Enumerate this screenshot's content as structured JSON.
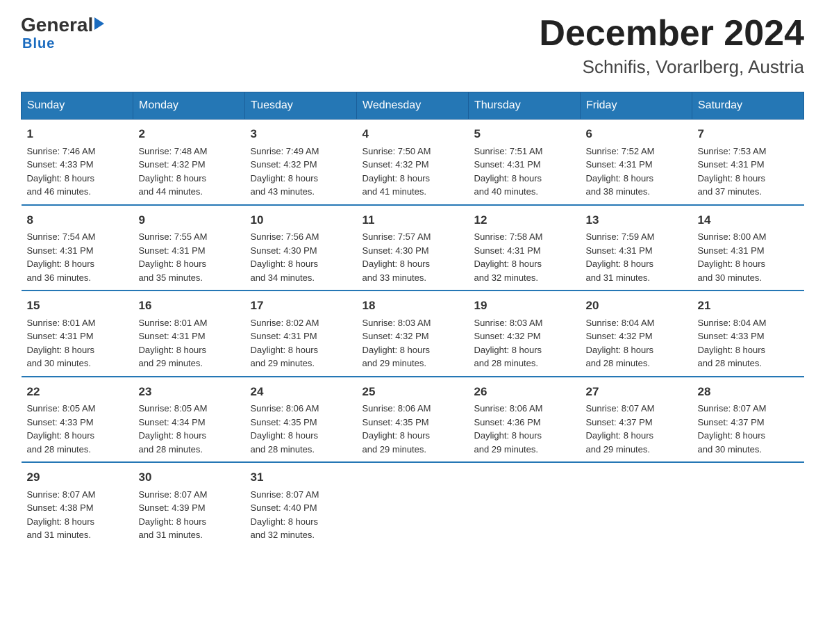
{
  "logo": {
    "general": "General",
    "arrow": "",
    "blue_underline": "Blue"
  },
  "title": "December 2024",
  "subtitle": "Schnifis, Vorarlberg, Austria",
  "days_of_week": [
    "Sunday",
    "Monday",
    "Tuesday",
    "Wednesday",
    "Thursday",
    "Friday",
    "Saturday"
  ],
  "weeks": [
    [
      {
        "day": "1",
        "sunrise": "7:46 AM",
        "sunset": "4:33 PM",
        "daylight": "8 hours and 46 minutes."
      },
      {
        "day": "2",
        "sunrise": "7:48 AM",
        "sunset": "4:32 PM",
        "daylight": "8 hours and 44 minutes."
      },
      {
        "day": "3",
        "sunrise": "7:49 AM",
        "sunset": "4:32 PM",
        "daylight": "8 hours and 43 minutes."
      },
      {
        "day": "4",
        "sunrise": "7:50 AM",
        "sunset": "4:32 PM",
        "daylight": "8 hours and 41 minutes."
      },
      {
        "day": "5",
        "sunrise": "7:51 AM",
        "sunset": "4:31 PM",
        "daylight": "8 hours and 40 minutes."
      },
      {
        "day": "6",
        "sunrise": "7:52 AM",
        "sunset": "4:31 PM",
        "daylight": "8 hours and 38 minutes."
      },
      {
        "day": "7",
        "sunrise": "7:53 AM",
        "sunset": "4:31 PM",
        "daylight": "8 hours and 37 minutes."
      }
    ],
    [
      {
        "day": "8",
        "sunrise": "7:54 AM",
        "sunset": "4:31 PM",
        "daylight": "8 hours and 36 minutes."
      },
      {
        "day": "9",
        "sunrise": "7:55 AM",
        "sunset": "4:31 PM",
        "daylight": "8 hours and 35 minutes."
      },
      {
        "day": "10",
        "sunrise": "7:56 AM",
        "sunset": "4:30 PM",
        "daylight": "8 hours and 34 minutes."
      },
      {
        "day": "11",
        "sunrise": "7:57 AM",
        "sunset": "4:30 PM",
        "daylight": "8 hours and 33 minutes."
      },
      {
        "day": "12",
        "sunrise": "7:58 AM",
        "sunset": "4:31 PM",
        "daylight": "8 hours and 32 minutes."
      },
      {
        "day": "13",
        "sunrise": "7:59 AM",
        "sunset": "4:31 PM",
        "daylight": "8 hours and 31 minutes."
      },
      {
        "day": "14",
        "sunrise": "8:00 AM",
        "sunset": "4:31 PM",
        "daylight": "8 hours and 30 minutes."
      }
    ],
    [
      {
        "day": "15",
        "sunrise": "8:01 AM",
        "sunset": "4:31 PM",
        "daylight": "8 hours and 30 minutes."
      },
      {
        "day": "16",
        "sunrise": "8:01 AM",
        "sunset": "4:31 PM",
        "daylight": "8 hours and 29 minutes."
      },
      {
        "day": "17",
        "sunrise": "8:02 AM",
        "sunset": "4:31 PM",
        "daylight": "8 hours and 29 minutes."
      },
      {
        "day": "18",
        "sunrise": "8:03 AM",
        "sunset": "4:32 PM",
        "daylight": "8 hours and 29 minutes."
      },
      {
        "day": "19",
        "sunrise": "8:03 AM",
        "sunset": "4:32 PM",
        "daylight": "8 hours and 28 minutes."
      },
      {
        "day": "20",
        "sunrise": "8:04 AM",
        "sunset": "4:32 PM",
        "daylight": "8 hours and 28 minutes."
      },
      {
        "day": "21",
        "sunrise": "8:04 AM",
        "sunset": "4:33 PM",
        "daylight": "8 hours and 28 minutes."
      }
    ],
    [
      {
        "day": "22",
        "sunrise": "8:05 AM",
        "sunset": "4:33 PM",
        "daylight": "8 hours and 28 minutes."
      },
      {
        "day": "23",
        "sunrise": "8:05 AM",
        "sunset": "4:34 PM",
        "daylight": "8 hours and 28 minutes."
      },
      {
        "day": "24",
        "sunrise": "8:06 AM",
        "sunset": "4:35 PM",
        "daylight": "8 hours and 28 minutes."
      },
      {
        "day": "25",
        "sunrise": "8:06 AM",
        "sunset": "4:35 PM",
        "daylight": "8 hours and 29 minutes."
      },
      {
        "day": "26",
        "sunrise": "8:06 AM",
        "sunset": "4:36 PM",
        "daylight": "8 hours and 29 minutes."
      },
      {
        "day": "27",
        "sunrise": "8:07 AM",
        "sunset": "4:37 PM",
        "daylight": "8 hours and 29 minutes."
      },
      {
        "day": "28",
        "sunrise": "8:07 AM",
        "sunset": "4:37 PM",
        "daylight": "8 hours and 30 minutes."
      }
    ],
    [
      {
        "day": "29",
        "sunrise": "8:07 AM",
        "sunset": "4:38 PM",
        "daylight": "8 hours and 31 minutes."
      },
      {
        "day": "30",
        "sunrise": "8:07 AM",
        "sunset": "4:39 PM",
        "daylight": "8 hours and 31 minutes."
      },
      {
        "day": "31",
        "sunrise": "8:07 AM",
        "sunset": "4:40 PM",
        "daylight": "8 hours and 32 minutes."
      },
      null,
      null,
      null,
      null
    ]
  ],
  "labels": {
    "sunrise": "Sunrise:",
    "sunset": "Sunset:",
    "daylight": "Daylight:"
  }
}
